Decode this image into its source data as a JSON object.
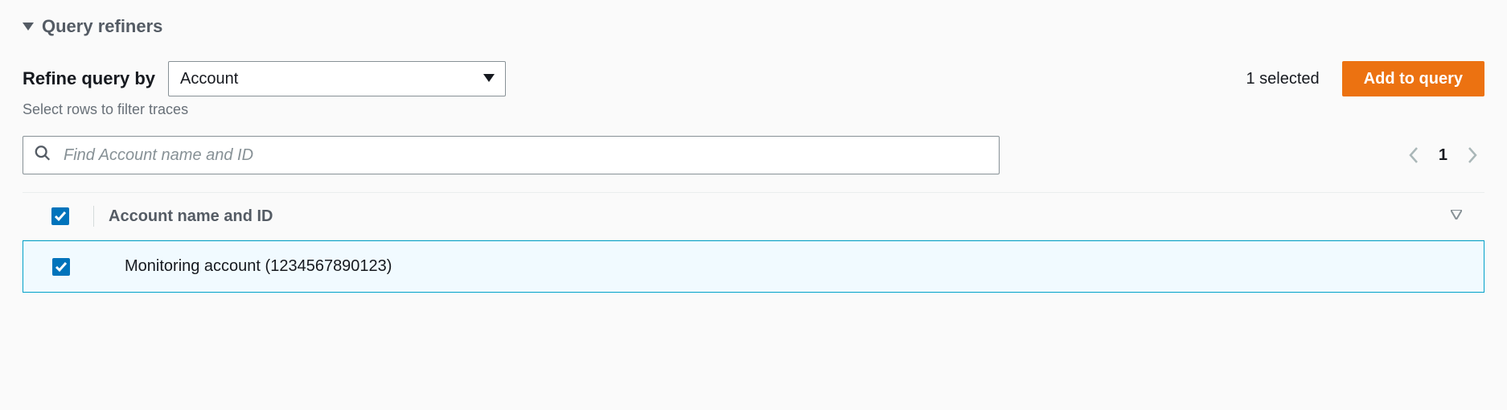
{
  "section": {
    "title": "Query refiners"
  },
  "refine": {
    "label": "Refine query by",
    "selected_option": "Account",
    "hint": "Select rows to filter traces"
  },
  "selection": {
    "count_text": "1 selected"
  },
  "actions": {
    "add_to_query": "Add to query"
  },
  "search": {
    "placeholder": "Find Account name and ID",
    "value": ""
  },
  "pagination": {
    "page": "1"
  },
  "table": {
    "header": "Account name and ID",
    "rows": [
      {
        "label": "Monitoring account (1234567890123)",
        "checked": true
      }
    ]
  }
}
